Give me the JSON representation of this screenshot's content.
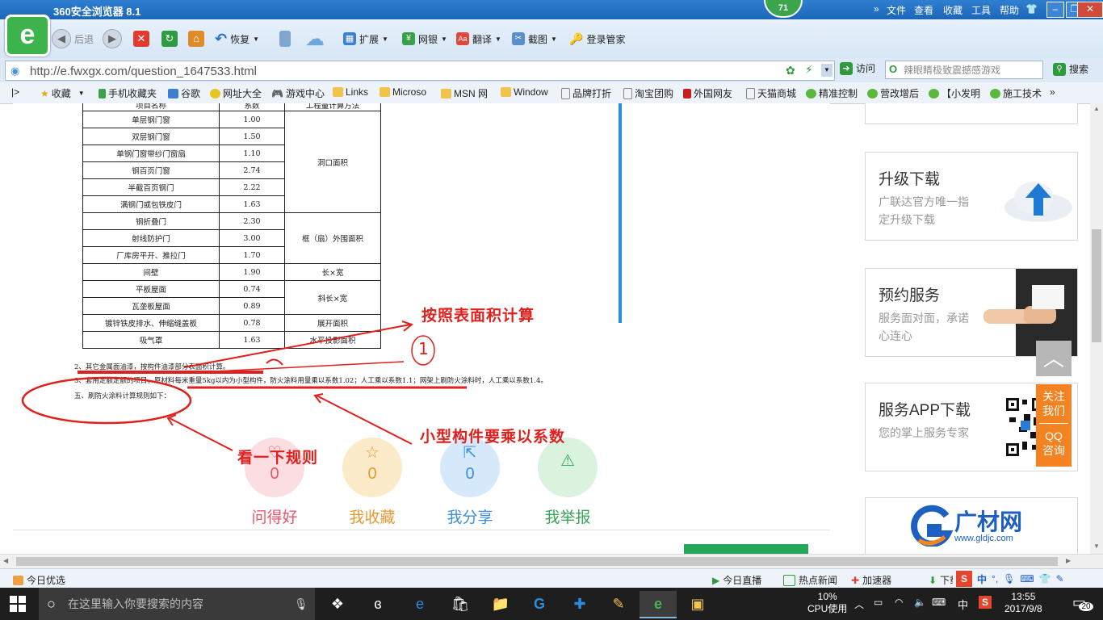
{
  "window": {
    "title": "360安全浏览器 8.1",
    "menu": [
      "文件",
      "查看",
      "收藏",
      "工具",
      "帮助"
    ],
    "badge": "71"
  },
  "toolbar": {
    "back": "后退",
    "restore": "恢复",
    "extensions": "扩展",
    "banking": "网银",
    "translate": "翻译",
    "screenshot": "截图",
    "login_manager": "登录管家"
  },
  "address": {
    "url": "http://e.fwxgx.com/question_1647533.html",
    "go_label": "访问",
    "search_placeholder": "辣眼睛极致震撼感游戏",
    "search_label": "搜索"
  },
  "favorites": [
    "收藏",
    "手机收藏夹",
    "谷歌",
    "网址大全",
    "游戏中心",
    "Links",
    "Microso",
    "MSN 网",
    "Window",
    "品牌打折",
    "淘宝团购",
    "外国网友",
    "天猫商城",
    "精准控制",
    "营改增后",
    "【小发明",
    "施工技术"
  ],
  "spec_table": {
    "header": [
      "项目名称",
      "系数",
      "工程量计算方法"
    ],
    "rows": [
      [
        "单层钢门窗",
        "1.00"
      ],
      [
        "双层钢门窗",
        "1.50"
      ],
      [
        "单钢门窗带纱门窗扇",
        "1.10"
      ],
      [
        "钢百页门窗",
        "2.74"
      ],
      [
        "半截百页钢门",
        "2.22"
      ],
      [
        "满钢门或包铁皮门",
        "1.63"
      ],
      [
        "钢折叠门",
        "2.30"
      ],
      [
        "射线防护门",
        "3.00"
      ],
      [
        "厂库房平开、推拉门",
        "1.70"
      ],
      [
        "间壁",
        "1.90"
      ],
      [
        "平板屋面",
        "0.74"
      ],
      [
        "瓦垄板屋面",
        "0.89"
      ],
      [
        "镀锌铁皮排水、伸缩缝盖板",
        "0.78"
      ],
      [
        "吸气罩",
        "1.63"
      ]
    ],
    "methods": [
      "洞口面积",
      "框（扇）外围面积",
      "长×宽",
      "斜长×宽",
      "展开面积",
      "水平投影面积"
    ]
  },
  "notes": {
    "n2": "2、其它金属面油漆，按构件油漆部分表面积计算。",
    "n3": "3、套用定额定额的项目，原材料每米重量5kg以内为小型构件，防火涂料用量乘以系数1.02；人工乘以系数1.1；网架上刷防火涂料时，人工乘以系数1.4。",
    "n5": "五、刷防火涂料计算规则如下："
  },
  "annotations": {
    "a1": "按照表面积计算",
    "a2": "小型构件要乘以系数",
    "a3": "看一下规则",
    "circled": "1"
  },
  "stats": [
    {
      "label": "问得好",
      "count": "0",
      "color": "#e8556b"
    },
    {
      "label": "我收藏",
      "count": "0",
      "color": "#e49a33"
    },
    {
      "label": "我分享",
      "count": "0",
      "color": "#3c8fd8"
    },
    {
      "label": "我举报",
      "count": "0",
      "color": "#3aa45a"
    }
  ],
  "sidebar": {
    "upgrade_title": "升级下载",
    "upgrade_sub": "广联达官方唯一指定升级下载",
    "booking_title": "预约服务",
    "booking_sub": "服务面对面，承诺心连心",
    "app_title": "服务APP下载",
    "app_sub": "您的掌上服务专家",
    "follow": "关注我们",
    "qq": "QQ咨询",
    "brand": "广材网",
    "brand_url": "www.gldjc.com"
  },
  "statusbar": {
    "left": "今日优选",
    "items": [
      "今日直播",
      "热点新闻",
      "加速器",
      "下载"
    ]
  },
  "taskbar": {
    "search_placeholder": "在这里输入你要搜索的内容",
    "cpu": "10%",
    "cpu_label": "CPU使用",
    "ime": "中",
    "time": "13:55",
    "date": "2017/9/8",
    "notifications": "20"
  }
}
